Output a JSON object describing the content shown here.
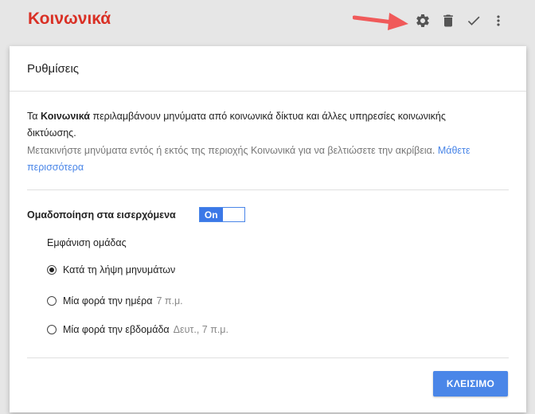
{
  "app": {
    "title": "Κοινωνικά",
    "title_color": "#d93025"
  },
  "toolbar": {
    "icons": [
      "gear-icon",
      "trash-icon",
      "check-icon",
      "more-vert-icon"
    ],
    "pointer_color": "#f05a5a"
  },
  "dialog": {
    "title": "Ρυθμίσεις",
    "intro_prefix": "Τα ",
    "intro_bold": "Κοινωνικά",
    "intro_suffix": " περιλαμβάνουν μηνύματα από κοινωνικά δίκτυα και άλλες υπηρεσίες κοινωνικής δικτύωσης.",
    "hint_text": "Μετακινήστε μηνύματα εντός ή εκτός της περιοχής Κοινωνικά για να βελτιώσετε την ακρίβεια. ",
    "learn_more": "Μάθετε περισσότερα",
    "group_label": "Ομαδοποίηση στα εισερχόμενα",
    "toggle_state": "On",
    "group_display_label": "Εμφάνιση ομάδας",
    "options": [
      {
        "label": "Κατά τη λήψη μηνυμάτων",
        "extra": "",
        "checked": true
      },
      {
        "label": "Μία φορά την ημέρα",
        "extra": "7 π.μ.",
        "checked": false
      },
      {
        "label": "Μία φορά την εβδομάδα",
        "extra": "Δευτ., 7 π.μ.",
        "checked": false
      }
    ],
    "close_label": "ΚΛΕΙΣΙΜΟ",
    "accent_color": "#4a86e8"
  }
}
